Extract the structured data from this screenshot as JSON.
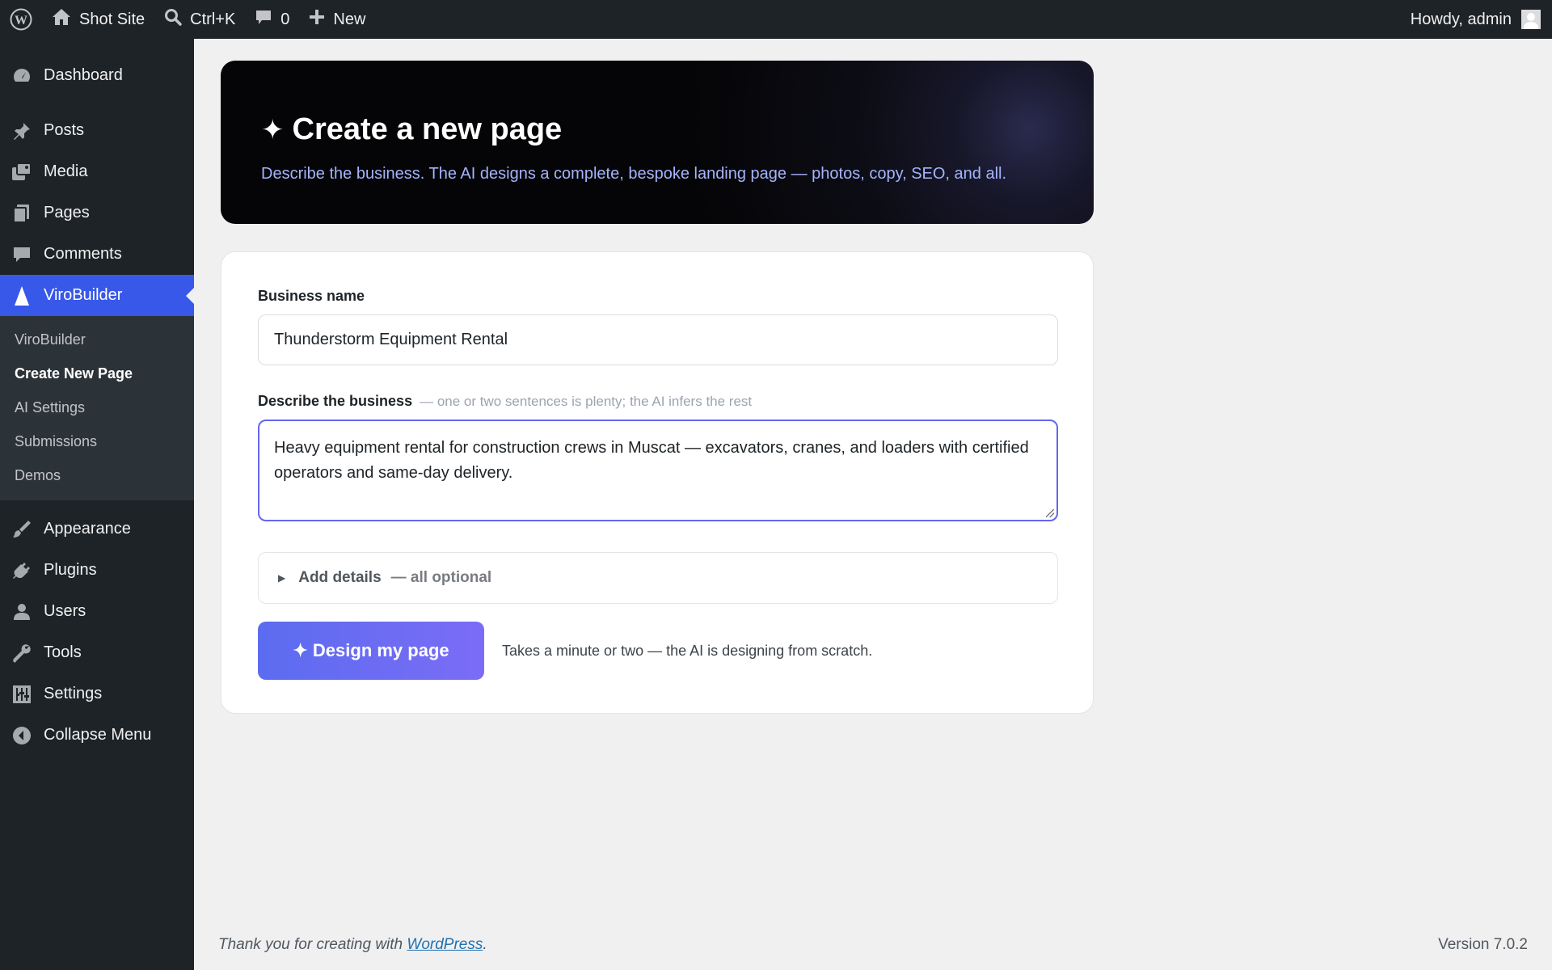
{
  "adminbar": {
    "site_name": "Shot Site",
    "search_shortcut": "Ctrl+K",
    "comments_count": "0",
    "new_label": "New",
    "howdy": "Howdy, admin"
  },
  "sidebar": {
    "items": [
      {
        "label": "Dashboard",
        "icon": "dashboard-icon"
      },
      {
        "label": "Posts",
        "icon": "pin-icon"
      },
      {
        "label": "Media",
        "icon": "media-icon"
      },
      {
        "label": "Pages",
        "icon": "pages-icon"
      },
      {
        "label": "Comments",
        "icon": "comment-icon"
      },
      {
        "label": "ViroBuilder",
        "icon": "virobuilder-icon"
      },
      {
        "label": "Appearance",
        "icon": "brush-icon"
      },
      {
        "label": "Plugins",
        "icon": "plug-icon"
      },
      {
        "label": "Users",
        "icon": "user-icon"
      },
      {
        "label": "Tools",
        "icon": "wrench-icon"
      },
      {
        "label": "Settings",
        "icon": "sliders-icon"
      },
      {
        "label": "Collapse Menu",
        "icon": "collapse-icon"
      }
    ],
    "submenu": [
      "ViroBuilder",
      "Create New Page",
      "AI Settings",
      "Submissions",
      "Demos"
    ]
  },
  "hero": {
    "title": "Create a new page",
    "subtitle": "Describe the business. The AI designs a complete, bespoke landing page — photos, copy, SEO, and all."
  },
  "form": {
    "business_name_label": "Business name",
    "business_name_value": "Thunderstorm Equipment Rental",
    "describe_label": "Describe the business",
    "describe_hint": "— one or two sentences is plenty; the AI infers the rest",
    "describe_value": "Heavy equipment rental for construction crews in Muscat — excavators, cranes, and loaders with certified operators and same-day delivery.",
    "details_label": "Add details",
    "details_optional": "— all optional",
    "submit_label": "✦ Design my page",
    "submit_note": "Takes a minute or two — the AI is designing from scratch."
  },
  "footer": {
    "thanks": "Thank you for creating with",
    "wordpress_link": "WordPress",
    "version": "Version 7.0.2"
  },
  "colors": {
    "accent": "#3858e9",
    "button": "#6366f1",
    "hero_subtitle": "#a5b4fc"
  }
}
